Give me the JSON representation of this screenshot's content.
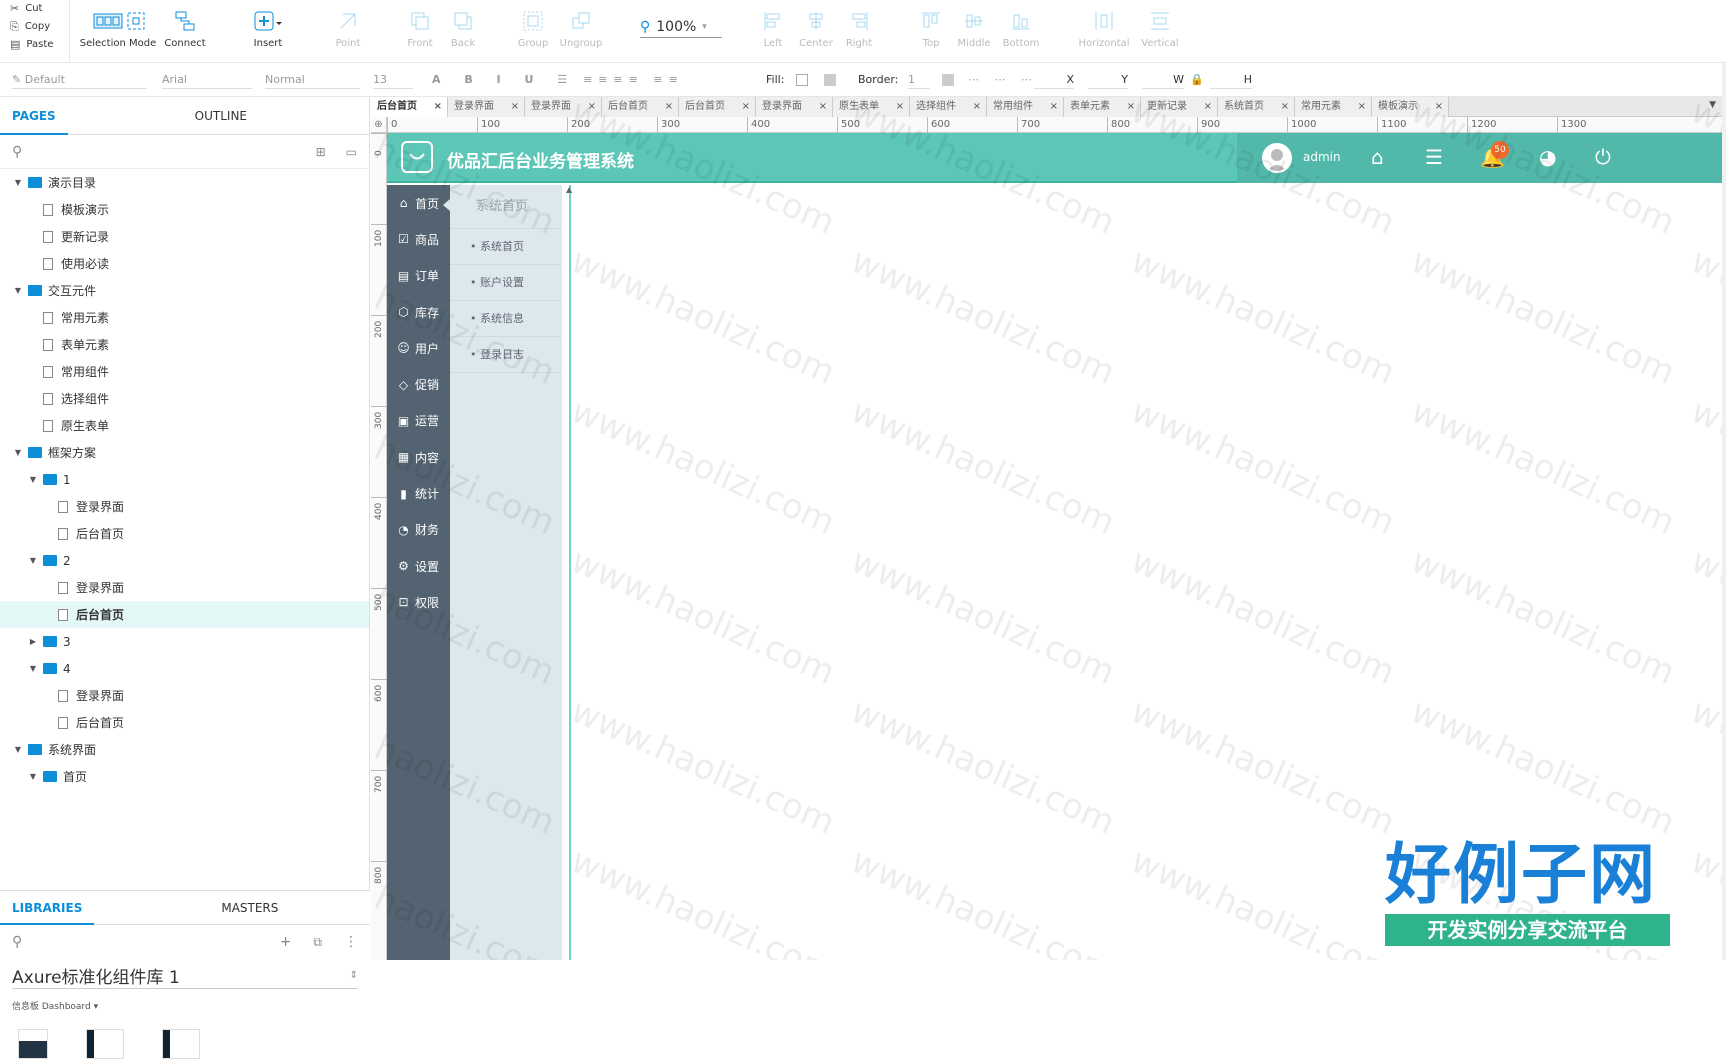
{
  "clipboard": {
    "cut": "Cut",
    "copy": "Copy",
    "paste": "Paste"
  },
  "toolbar": {
    "selection_mode": "Selection Mode",
    "connect": "Connect",
    "insert": "Insert",
    "point": "Point",
    "front": "Front",
    "back": "Back",
    "group": "Group",
    "ungroup": "Ungroup",
    "zoom": "100%",
    "left": "Left",
    "center": "Center",
    "right": "Right",
    "top": "Top",
    "middle": "Middle",
    "bottom": "Bottom",
    "horizontal": "Horizontal",
    "vertical": "Vertical"
  },
  "format": {
    "style": "Default",
    "font": "Arial",
    "weight": "Normal",
    "size": "13",
    "fill_label": "Fill:",
    "border_label": "Border:",
    "border_value": "1",
    "x": "X",
    "y": "Y",
    "w": "W",
    "h": "H"
  },
  "pages_panel": {
    "tab_pages": "PAGES",
    "tab_outline": "OUTLINE",
    "tree": [
      {
        "label": "演示目录",
        "type": "folder",
        "level": 0
      },
      {
        "label": "模板演示",
        "type": "page",
        "level": 1
      },
      {
        "label": "更新记录",
        "type": "page",
        "level": 1
      },
      {
        "label": "使用必读",
        "type": "page",
        "level": 1
      },
      {
        "label": "交互元件",
        "type": "folder",
        "level": 0
      },
      {
        "label": "常用元素",
        "type": "page",
        "level": 1
      },
      {
        "label": "表单元素",
        "type": "page",
        "level": 1
      },
      {
        "label": "常用组件",
        "type": "page",
        "level": 1
      },
      {
        "label": "选择组件",
        "type": "page",
        "level": 1
      },
      {
        "label": "原生表单",
        "type": "page",
        "level": 1
      },
      {
        "label": "框架方案",
        "type": "folder",
        "level": 0
      },
      {
        "label": "1",
        "type": "folder",
        "level": 1
      },
      {
        "label": "登录界面",
        "type": "page",
        "level": 2
      },
      {
        "label": "后台首页",
        "type": "page",
        "level": 2
      },
      {
        "label": "2",
        "type": "folder",
        "level": 1
      },
      {
        "label": "登录界面",
        "type": "page",
        "level": 2
      },
      {
        "label": "后台首页",
        "type": "page",
        "level": 2,
        "selected": true
      },
      {
        "label": "3",
        "type": "folder",
        "level": 1,
        "collapsed": true
      },
      {
        "label": "4",
        "type": "folder",
        "level": 1
      },
      {
        "label": "登录界面",
        "type": "page",
        "level": 2
      },
      {
        "label": "后台首页",
        "type": "page",
        "level": 2
      },
      {
        "label": "系统界面",
        "type": "folder",
        "level": 0
      },
      {
        "label": "首页",
        "type": "folder",
        "level": 1
      }
    ]
  },
  "libraries_panel": {
    "tab_libraries": "LIBRARIES",
    "tab_masters": "MASTERS",
    "library_name": "Axure标准化组件库 1",
    "category": "信息板 Dashboard"
  },
  "page_tabs": [
    "后台首页",
    "登录界面",
    "登录界面",
    "后台首页",
    "后台首页",
    "登录界面",
    "原生表单",
    "选择组件",
    "常用组件",
    "表单元素",
    "更新记录",
    "系统首页",
    "常用元素",
    "模板演示"
  ],
  "ruler_h": [
    "0",
    "100",
    "200",
    "300",
    "400",
    "500",
    "600",
    "700",
    "800",
    "900",
    "1000",
    "1100",
    "1200",
    "1300"
  ],
  "ruler_v": [
    "0",
    "100",
    "200",
    "300",
    "400",
    "500",
    "600",
    "700",
    "800"
  ],
  "design": {
    "app_title": "优品汇后台业务管理系统",
    "user": "admin",
    "notification_count": "50",
    "nav": [
      "首页",
      "商品",
      "订单",
      "库存",
      "用户",
      "促销",
      "运营",
      "内容",
      "统计",
      "财务",
      "设置",
      "权限"
    ],
    "nav_icons": [
      "home-icon",
      "goods-icon",
      "order-icon",
      "inventory-icon",
      "user-icon",
      "promotion-icon",
      "operation-icon",
      "content-icon",
      "chart-icon",
      "finance-icon",
      "settings-icon",
      "lock-icon"
    ],
    "submenu_title": "系统首页",
    "submenu": [
      "系统首页",
      "账户设置",
      "系统信息",
      "登录日志"
    ],
    "colors": {
      "header": "#5cc6b7",
      "sidebar": "#536371",
      "submenu": "#dce8ec"
    }
  },
  "watermark": "www.haolizi.com",
  "brand": {
    "title": "好例子网",
    "subtitle": "开发实例分享交流平台"
  }
}
